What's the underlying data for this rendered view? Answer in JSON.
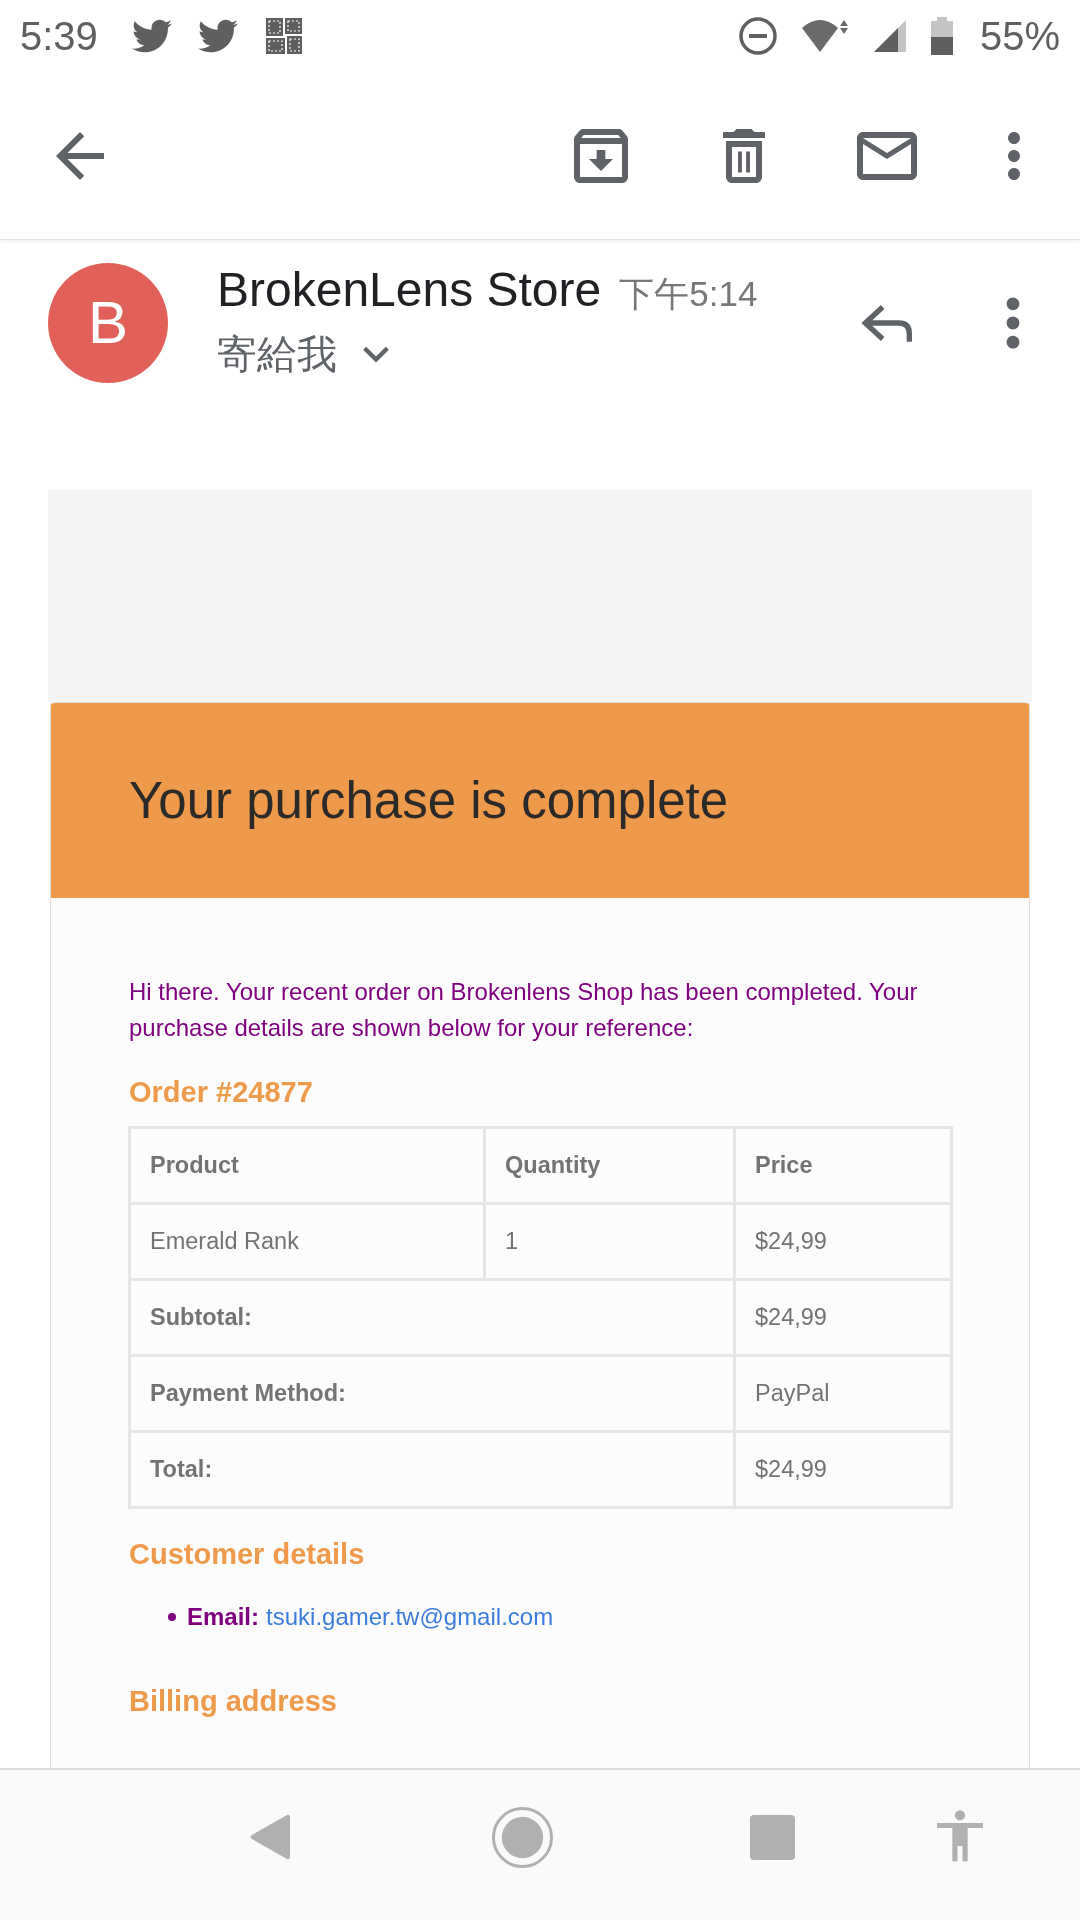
{
  "status_bar": {
    "time": "5:39",
    "battery": "55%"
  },
  "message": {
    "avatar_letter": "B",
    "sender": "BrokenLens Store",
    "time": "下午5:14",
    "recipient": "寄給我"
  },
  "email": {
    "title": "Your purchase is complete",
    "intro": "Hi there. Your recent order on Brokenlens Shop has been completed. Your purchase details are shown below for your reference:",
    "order_heading": "Order #24877",
    "table": {
      "columns": [
        "Product",
        "Quantity",
        "Price"
      ],
      "rows": [
        {
          "kind": "item",
          "cells": [
            "Emerald Rank",
            "1",
            "$24,99"
          ]
        },
        {
          "kind": "summary",
          "label": "Subtotal:",
          "value": "$24,99"
        },
        {
          "kind": "summary",
          "label": "Payment Method:",
          "value": "PayPal"
        },
        {
          "kind": "summary",
          "label": "Total:",
          "value": "$24,99"
        }
      ]
    },
    "customer_heading": "Customer details",
    "customer_fields": [
      {
        "label": "Email:",
        "value": "tsuki.gamer.tw@gmail.com"
      }
    ],
    "billing_heading": "Billing address"
  }
}
